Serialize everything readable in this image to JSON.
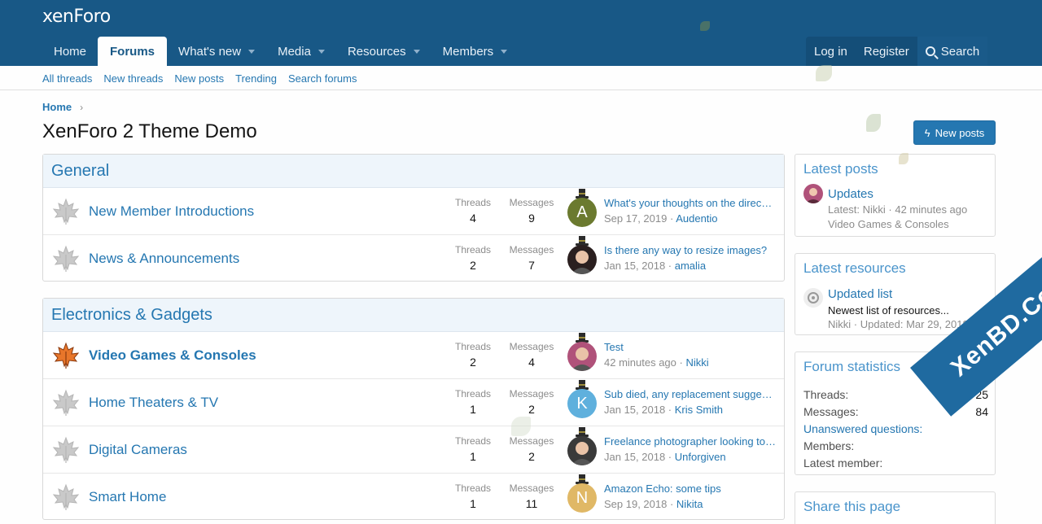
{
  "header": {
    "logo": "xenForo",
    "nav": [
      {
        "label": "Home",
        "has_menu": false,
        "active": false
      },
      {
        "label": "Forums",
        "has_menu": false,
        "active": true
      },
      {
        "label": "What's new",
        "has_menu": true,
        "active": false
      },
      {
        "label": "Media",
        "has_menu": true,
        "active": false
      },
      {
        "label": "Resources",
        "has_menu": true,
        "active": false
      },
      {
        "label": "Members",
        "has_menu": true,
        "active": false
      }
    ],
    "login": "Log in",
    "register": "Register",
    "search": "Search"
  },
  "subnav": [
    "All threads",
    "New threads",
    "New posts",
    "Trending",
    "Search forums"
  ],
  "breadcrumb": "Home",
  "page_title": "XenForo 2 Theme Demo",
  "new_posts_button": "New posts",
  "stat_labels": {
    "threads": "Threads",
    "messages": "Messages"
  },
  "categories": [
    {
      "title": "General",
      "nodes": [
        {
          "title": "New Member Introductions",
          "unread": false,
          "threads": "4",
          "messages": "9",
          "last_title": "What's your thoughts on the direc…",
          "last_date": "Sep 17, 2019",
          "last_user": "Audentio",
          "avatar_letter": "A",
          "avatar_color": "#6b7a2f",
          "avatar_type": "letter"
        },
        {
          "title": "News & Announcements",
          "unread": false,
          "threads": "2",
          "messages": "7",
          "last_title": "Is there any way to resize images?",
          "last_date": "Jan 15, 2018",
          "last_user": "amalia",
          "avatar_letter": "",
          "avatar_color": "#2a1f1f",
          "avatar_type": "photo"
        }
      ]
    },
    {
      "title": "Electronics & Gadgets",
      "nodes": [
        {
          "title": "Video Games & Consoles",
          "unread": true,
          "threads": "2",
          "messages": "4",
          "last_title": "Test",
          "last_date": "42 minutes ago",
          "last_user": "Nikki",
          "avatar_letter": "",
          "avatar_color": "#b0527a",
          "avatar_type": "photo"
        },
        {
          "title": "Home Theaters & TV",
          "unread": false,
          "threads": "1",
          "messages": "2",
          "last_title": "Sub died, any replacement sugge…",
          "last_date": "Jan 15, 2018",
          "last_user": "Kris Smith",
          "avatar_letter": "K",
          "avatar_color": "#5fb0dd",
          "avatar_type": "letter"
        },
        {
          "title": "Digital Cameras",
          "unread": false,
          "threads": "1",
          "messages": "2",
          "last_title": "Freelance photographer looking to…",
          "last_date": "Jan 15, 2018",
          "last_user": "Unforgiven",
          "avatar_letter": "",
          "avatar_color": "#3a3a3a",
          "avatar_type": "photo"
        },
        {
          "title": "Smart Home",
          "unread": false,
          "threads": "1",
          "messages": "11",
          "last_title": "Amazon Echo: some tips",
          "last_date": "Sep 19, 2018",
          "last_user": "Nikita",
          "avatar_letter": "N",
          "avatar_color": "#e0b866",
          "avatar_type": "letter"
        }
      ]
    }
  ],
  "sidebar": {
    "latest_posts": {
      "title": "Latest posts",
      "thread": "Updates",
      "meta": "Latest: Nikki · 42 minutes ago",
      "forum": "Video Games & Consoles"
    },
    "latest_resources": {
      "title": "Latest resources",
      "resource": "Updated list",
      "tagline": "Newest list of resources...",
      "meta": "Nikki · Updated: Mar 29, 2018"
    },
    "forum_statistics": {
      "title": "Forum statistics",
      "rows": [
        {
          "label": "Threads:",
          "value": "25",
          "link": false
        },
        {
          "label": "Messages:",
          "value": "84",
          "link": false
        },
        {
          "label": "Unanswered questions:",
          "value": "",
          "link": true
        },
        {
          "label": "Members:",
          "value": "",
          "link": false
        },
        {
          "label": "Latest member:",
          "value": "",
          "link": false
        }
      ]
    },
    "share": {
      "title": "Share this page"
    }
  },
  "watermark": "XenBD.Com",
  "colors": {
    "header": "#185886",
    "link": "#2577b1",
    "accent": "#4a94cb",
    "muted": "#8c8c8c"
  }
}
